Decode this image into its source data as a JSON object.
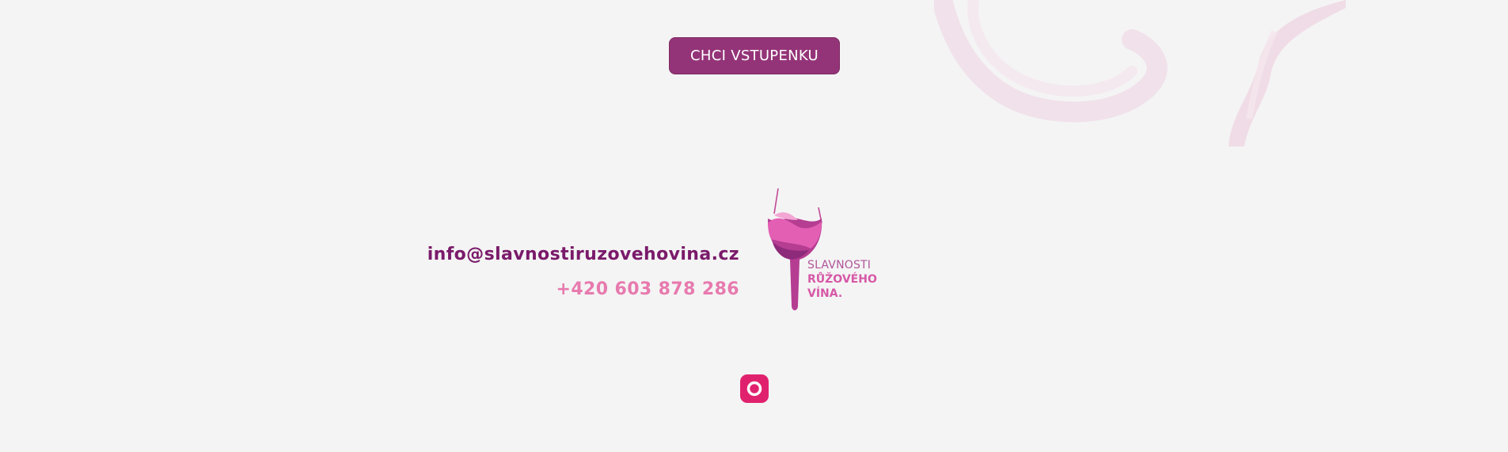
{
  "cta": {
    "label": "CHCI VSTUPENKU"
  },
  "contact": {
    "email": "info@slavnostiruzovehovina.cz",
    "phone": "+420 603 878 286"
  },
  "logo": {
    "line1": "SLAVNOSTI",
    "line2": "RŮŽOVÉHO",
    "line3": "VÍNA."
  },
  "social": {
    "icon": "instagram-icon"
  },
  "colors": {
    "background": "#f4f4f4",
    "button": "#943478",
    "email": "#7a1a6a",
    "phone": "#e77aae",
    "instagram": "#e0226e"
  }
}
